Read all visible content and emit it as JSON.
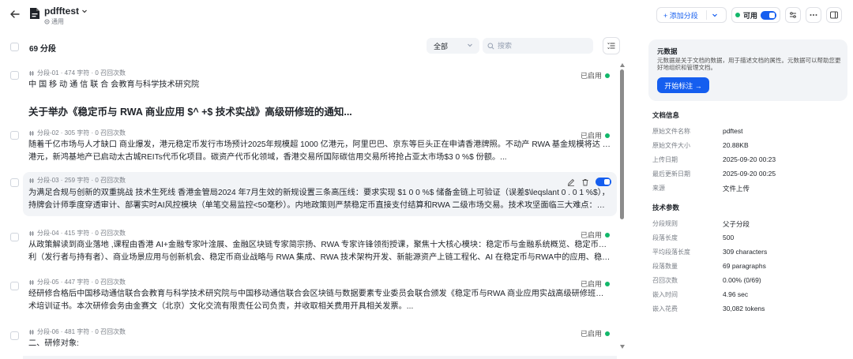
{
  "header": {
    "doc_title": "pdfftest",
    "doc_subtitle": "通用",
    "add_segment_label": "+ 添加分段",
    "status_label": "可用",
    "colors": {
      "accent": "#155eef",
      "status_green": "#12b76a"
    }
  },
  "toolbar": {
    "segment_count": "69 分段",
    "filter_value": "全部",
    "search_placeholder": "搜索"
  },
  "segments": [
    {
      "meta": "分段-01 · 474 字符 · 0 召回次数",
      "status": "已启用",
      "lines": [
        "中 国 移 动 通 信 联 合 会教育与科学技术研究院"
      ],
      "heading": "关于举办《稳定币与 RWA 商业应用 $^ +$ 技术实战》高级研修班的通知..."
    },
    {
      "meta": "分段-02 · 305 字符 · 0 召回次数",
      "status": "已启用",
      "lines": [
        "随着千亿市场与人才缺口 商业爆发，港元稳定币发行市场预计2025年规模超 1000 亿港元，阿里巴巴、京东等巨头正在申请香港牌照。不动产 RWA 基金规模将达 300 亿",
        "港元，新鸿基地产已启动太古城REITs代币化项目。碳资产代币化领域，香港交易所国际碳信用交易所将抢占亚太市场$3 0 %$ 份额。..."
      ]
    },
    {
      "meta": "分段-03 · 259 字符 · 0 召回次数",
      "status": "",
      "lines": [
        "为满足合规与创新的双重挑战 技术生死线 香港金管局2024 年7月生效的新规设置三条高压线：要求实现 $1 0 0 %$ 储备金链上可验证（误差$\\leqslant 0 . 0 1 %$），",
        "持牌会计师季度穿透审计、部署实时AI风控模块（单笔交易监控<50毫秒）。内地政策则严禁稳定币直接支付结算和RWA 二级市场交易。技术攻坚面临三大难点：跨境..."
      ]
    },
    {
      "meta": "分段-04 · 415 字符 · 0 召回次数",
      "status": "已启用",
      "lines": [
        "从政策解读到商业落地 ,课程由香港 AI+金融专家叶淦展、金融区块链专家简宗扬、RWA 专家许锋领衔授课，聚焦十大核心模块：稳定币与金融系统概览、稳定币如何盈",
        "利（发行者与持有者）、商业场景应用与创新机会、稳定币商业战略与 RWA 集成、RWA 技术架构开发、新能源资产上链工程化、AI 在稳定币与RWA中的应用、稳定币..."
      ]
    },
    {
      "meta": "分段-05 · 447 字符 · 0 召回次数",
      "status": "已启用",
      "lines": [
        "经研修合格后中国移动通信联合会教育与科学技术研究院与中国移动通信联合会区块链与数据要素专业委员会联合颁发《稳定币与RWA 商业应用实战高级研修班》专项技",
        "术培训证书。本次研修会务由金赛文（北京）文化交流有限责任公司负责，并收取相关费用开具相关发票。..."
      ]
    },
    {
      "meta": "分段-06 · 481 字符 · 0 召回次数",
      "status": "已启用",
      "lines": [
        "二、研修对象:"
      ]
    }
  ],
  "panel": {
    "metadata": {
      "title": "元数据",
      "desc": "元数据是关于文档的数据，用于描述文档的属性。元数据可以帮助您更好地组织和管理文档。",
      "start_label": "开始标注 →"
    },
    "doc_info": {
      "title": "文档信息",
      "rows": [
        {
          "k": "原始文件名称",
          "v": "pdftest"
        },
        {
          "k": "原始文件大小",
          "v": "20.88KB"
        },
        {
          "k": "上传日期",
          "v": "2025-09-20 00:23"
        },
        {
          "k": "最后更新日期",
          "v": "2025-09-20 00:25"
        },
        {
          "k": "来源",
          "v": "文件上传"
        }
      ]
    },
    "tech": {
      "title": "技术参数",
      "rows": [
        {
          "k": "分段规则",
          "v": "父子分段"
        },
        {
          "k": "段落长度",
          "v": "500"
        },
        {
          "k": "平均段落长度",
          "v": "309 characters"
        },
        {
          "k": "段落数量",
          "v": "69 paragraphs"
        },
        {
          "k": "召回次数",
          "v": "0.00% (0/69)"
        },
        {
          "k": "嵌入时间",
          "v": "4.96 sec"
        },
        {
          "k": "嵌入花费",
          "v": "30,082 tokens"
        }
      ]
    }
  }
}
